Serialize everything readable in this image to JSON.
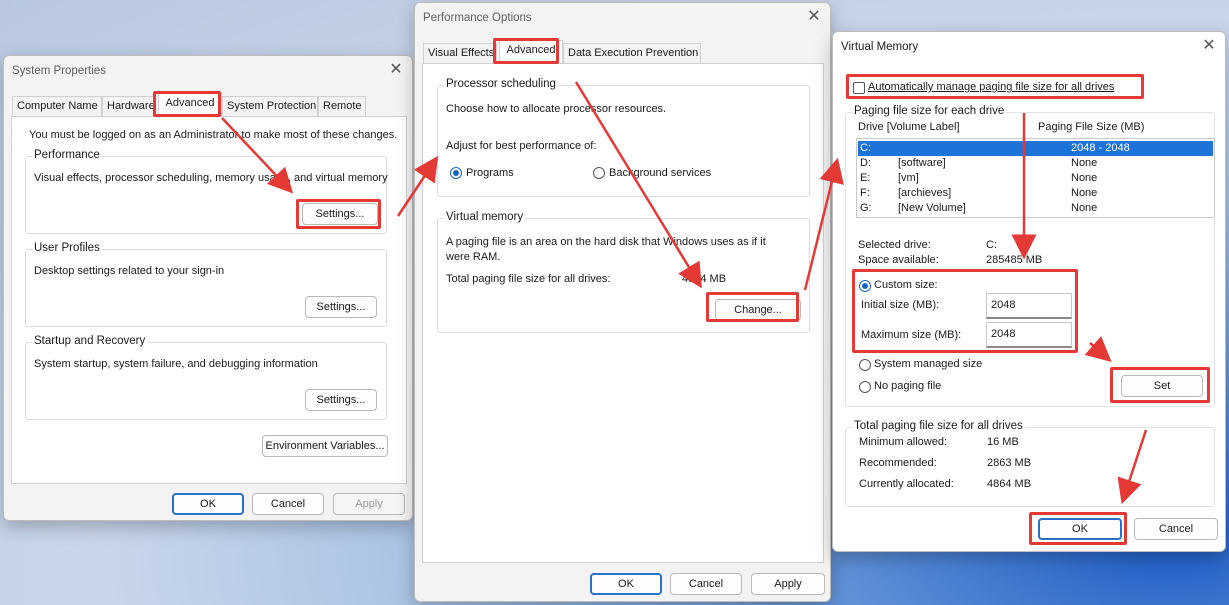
{
  "system_properties": {
    "title": "System Properties",
    "tabs": [
      "Computer Name",
      "Hardware",
      "Advanced",
      "System Protection",
      "Remote"
    ],
    "admin_note": "You must be logged on as an Administrator to make most of these changes.",
    "performance": {
      "label": "Performance",
      "desc": "Visual effects, processor scheduling, memory usage, and virtual memory",
      "button": "Settings..."
    },
    "user_profiles": {
      "label": "User Profiles",
      "desc": "Desktop settings related to your sign-in",
      "button": "Settings..."
    },
    "startup": {
      "label": "Startup and Recovery",
      "desc": "System startup, system failure, and debugging information",
      "button": "Settings..."
    },
    "env_button": "Environment Variables...",
    "ok": "OK",
    "cancel": "Cancel",
    "apply": "Apply"
  },
  "performance_options": {
    "title": "Performance Options",
    "tabs": [
      "Visual Effects",
      "Advanced",
      "Data Execution Prevention"
    ],
    "processor": {
      "label": "Processor scheduling",
      "desc": "Choose how to allocate processor resources.",
      "adjust": "Adjust for best performance of:",
      "opt_programs": "Programs",
      "opt_background": "Background services"
    },
    "vm": {
      "label": "Virtual memory",
      "desc1": "A paging file is an area on the hard disk that Windows uses as if it",
      "desc2": "were RAM.",
      "total_label": "Total paging file size for all drives:",
      "total_value": "4864 MB",
      "change": "Change..."
    },
    "ok": "OK",
    "cancel": "Cancel",
    "apply": "Apply"
  },
  "virtual_memory": {
    "title": "Virtual Memory",
    "auto_manage": "Automatically manage paging file size for all drives",
    "each_drive": "Paging file size for each drive",
    "col_drive": "Drive  [Volume Label]",
    "col_size": "Paging File Size (MB)",
    "drives": [
      {
        "drive": "C:",
        "label": "",
        "size": "2048 - 2048"
      },
      {
        "drive": "D:",
        "label": "[software]",
        "size": "None"
      },
      {
        "drive": "E:",
        "label": "[vm]",
        "size": "None"
      },
      {
        "drive": "F:",
        "label": "[archieves]",
        "size": "None"
      },
      {
        "drive": "G:",
        "label": "[New Volume]",
        "size": "None"
      }
    ],
    "selected_drive_label": "Selected drive:",
    "selected_drive_value": "C:",
    "space_label": "Space available:",
    "space_value": "285485 MB",
    "custom_size": "Custom size:",
    "initial_label": "Initial size (MB):",
    "initial_value": "2048",
    "max_label": "Maximum size (MB):",
    "max_value": "2048",
    "system_managed": "System managed size",
    "no_paging": "No paging file",
    "set": "Set",
    "total_label": "Total paging file size for all drives",
    "min_label": "Minimum allowed:",
    "min_value": "16 MB",
    "rec_label": "Recommended:",
    "rec_value": "2863 MB",
    "cur_label": "Currently allocated:",
    "cur_value": "4864 MB",
    "ok": "OK",
    "cancel": "Cancel"
  },
  "colors": {
    "highlight": "#e53935",
    "selection": "#1e73d8",
    "accent": "#1565c0"
  }
}
